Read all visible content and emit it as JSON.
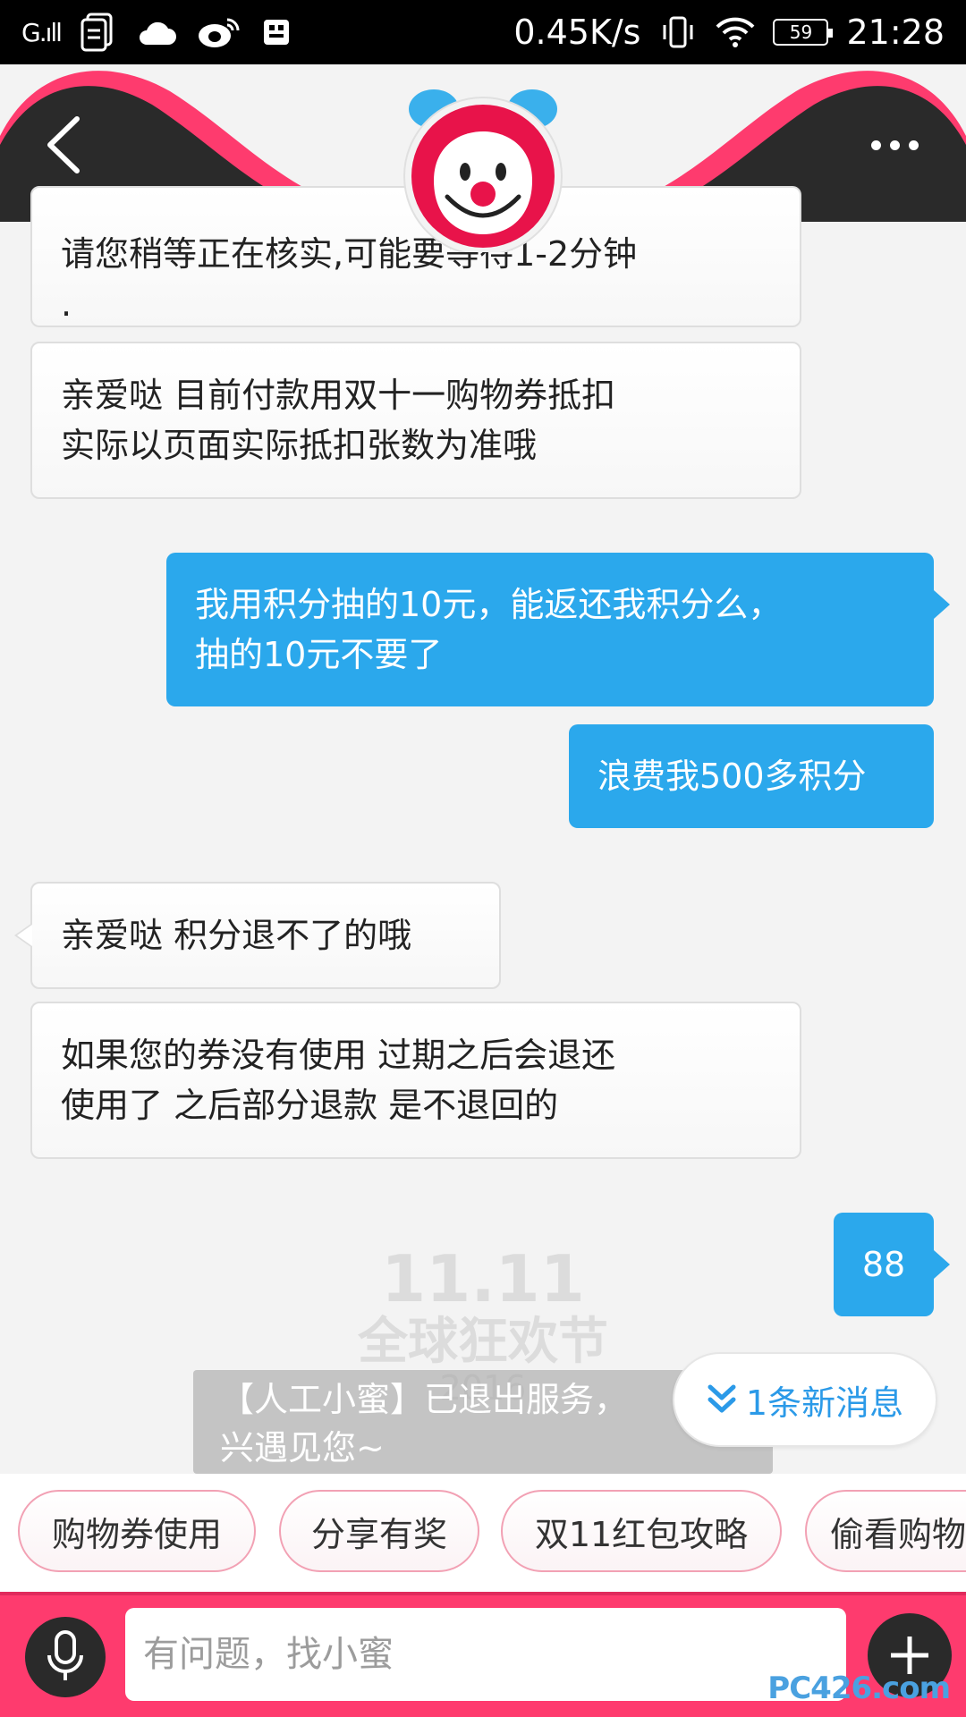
{
  "status_bar": {
    "signal": "G.ıll",
    "speed": "0.45K/s",
    "battery": "59",
    "time": "21:28"
  },
  "header": {
    "back_icon": "back-chevron-icon",
    "more_icon": "more-dots-icon",
    "mascot": "mascot-avatar"
  },
  "messages": [
    {
      "side": "in",
      "text": "请您稍等正在核实,可能要等待1-2分钟",
      "text2": "."
    },
    {
      "side": "in",
      "text": "亲爱哒   目前付款用双十一购物券抵扣",
      "text2": "实际以页面实际抵扣张数为准哦"
    },
    {
      "side": "out",
      "text": "我用积分抽的10元，能返还我积分么，",
      "text2": "抽的10元不要了"
    },
    {
      "side": "out",
      "text": "浪费我500多积分"
    },
    {
      "side": "in",
      "text": "亲爱哒 积分退不了的哦"
    },
    {
      "side": "in",
      "text": "如果您的券没有使用  过期之后会退还",
      "text2": "使用了 之后部分退款 是不退回的"
    },
    {
      "side": "out",
      "text": "88"
    }
  ],
  "watermark": {
    "line1": "11.11",
    "line2": "全球狂欢节",
    "line3": "2016"
  },
  "toast": {
    "line1": "【人工小蜜】已退出服务，",
    "line2": "兴遇见您~"
  },
  "new_message_pill": {
    "label": "1条新消息",
    "icon": "double-chevron-down-icon"
  },
  "quick_chips": [
    {
      "label": "购物券使用"
    },
    {
      "label": "分享有奖"
    },
    {
      "label": "双11红包攻略"
    },
    {
      "label": "偷看购物"
    }
  ],
  "input_bar": {
    "placeholder": "有问题，找小蜜",
    "mic_icon": "microphone-icon",
    "plus_icon": "plus-icon"
  },
  "site_mark": "PC426.com",
  "colors": {
    "accent_pink": "#fe3b6e",
    "outgoing_bubble": "#2ba8ec",
    "link_blue": "#2b9ae8",
    "chip_border": "#f2a1b4"
  }
}
